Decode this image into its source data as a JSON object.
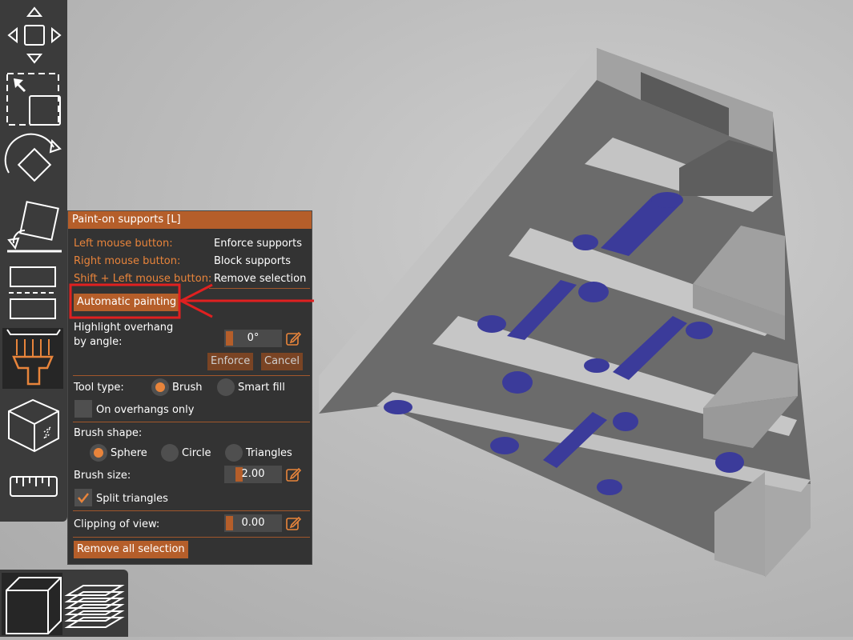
{
  "panel": {
    "title": "Paint-on supports [L]",
    "hints": [
      {
        "label": "Left mouse button:",
        "action": "Enforce supports"
      },
      {
        "label": "Right mouse button:",
        "action": "Block supports"
      },
      {
        "label": "Shift + Left mouse button:",
        "action": "Remove selection"
      }
    ],
    "automatic_painting": "Automatic painting",
    "highlight_overhang_line1": "Highlight overhang",
    "highlight_overhang_line2": "by angle:",
    "angle_value": "0°",
    "enforce": "Enforce",
    "cancel": "Cancel",
    "tool_type_label": "Tool type:",
    "tool_types": [
      "Brush",
      "Smart fill"
    ],
    "tool_type_selected": "Brush",
    "on_overhangs_only": "On overhangs only",
    "on_overhangs_only_checked": false,
    "brush_shape_label": "Brush shape:",
    "brush_shapes": [
      "Sphere",
      "Circle",
      "Triangles"
    ],
    "brush_shape_selected": "Sphere",
    "brush_size_label": "Brush size:",
    "brush_size_value": "2.00",
    "split_triangles": "Split triangles",
    "split_triangles_checked": true,
    "clipping_label": "Clipping of view:",
    "clipping_value": "0.00",
    "remove_all": "Remove all selection"
  },
  "toolbar": {
    "tools": [
      "move-icon",
      "scale-icon",
      "rotate-icon",
      "place-on-face-icon",
      "cut-icon",
      "paint-supports-icon",
      "seam-icon",
      "measure-icon"
    ],
    "active_tool": "paint-supports-icon"
  },
  "view_toggle": {
    "views": [
      "3d-view-icon",
      "preview-layers-icon"
    ],
    "active_view": "3d-view-icon"
  },
  "colors": {
    "accent": "#b55e2a",
    "accent_text": "#e8843b",
    "panel_bg": "#333333",
    "support_paint": "#3b3b9a",
    "annotation": "#e02020"
  }
}
